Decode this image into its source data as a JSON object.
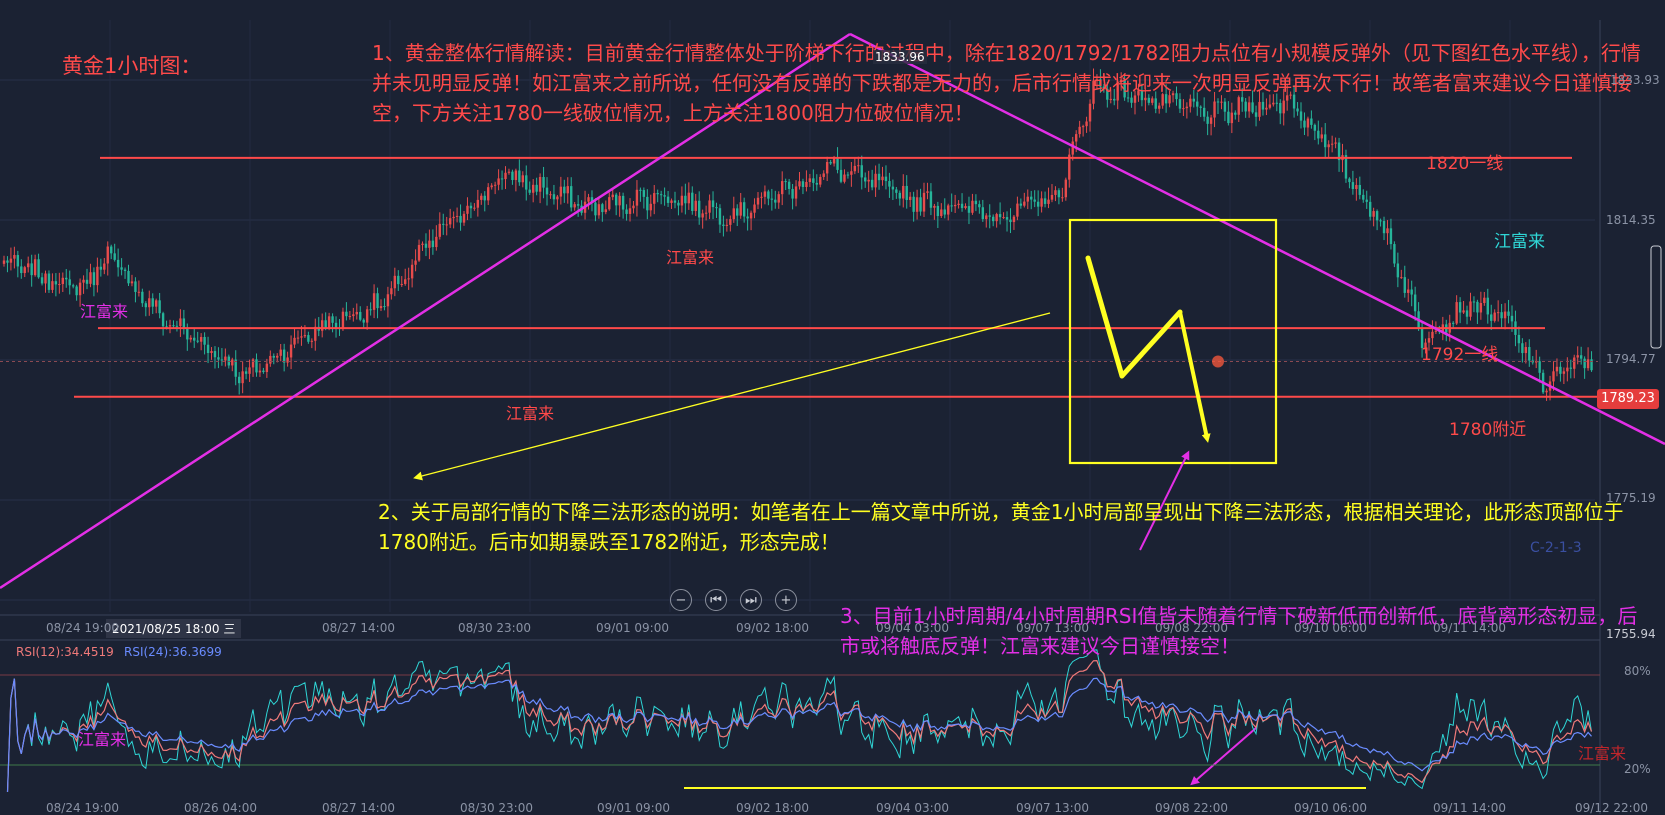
{
  "colors": {
    "background": "#1b2233",
    "candle_up": "#e74c4c",
    "candle_down": "#26b59a",
    "level_line": "#ff4a4a",
    "trend_line": "#e32fe6",
    "annotation_yellow": "#ffff22",
    "rsi12": "#f07a7a",
    "rsi24": "#6a8cff",
    "rsi6": "#2fd6d6",
    "price_tag_bg": "#e53d3d"
  },
  "chart_data": [
    {
      "type": "candlestick",
      "title": "黄金1小时图：",
      "ylim": [
        1752,
        1840
      ],
      "price_axis_labels": [
        "1833.93",
        "1814.35",
        "1794.77",
        "1775.19",
        "1755.94"
      ],
      "last_price": "1789.23",
      "high_label": "1833.96",
      "hover_time": "2021/08/25 18:00 三",
      "time_labels": [
        "08/24 19:00",
        "08/27 14:00",
        "08/30 23:00",
        "09/01 09:00",
        "09/02 18:00",
        "09/04 03:00",
        "09/07 13:00",
        "09/08 22:00",
        "09/10 06:00",
        "09/11 14:00"
      ],
      "keypoints": [
        {
          "i": 0,
          "p": 1804
        },
        {
          "i": 22,
          "p": 1800
        },
        {
          "i": 30,
          "p": 1805
        },
        {
          "i": 45,
          "p": 1796
        },
        {
          "i": 60,
          "p": 1791
        },
        {
          "i": 70,
          "p": 1787
        },
        {
          "i": 90,
          "p": 1794
        },
        {
          "i": 110,
          "p": 1798
        },
        {
          "i": 125,
          "p": 1808
        },
        {
          "i": 145,
          "p": 1817
        },
        {
          "i": 170,
          "p": 1812
        },
        {
          "i": 190,
          "p": 1814
        },
        {
          "i": 210,
          "p": 1811
        },
        {
          "i": 240,
          "p": 1818
        },
        {
          "i": 265,
          "p": 1813
        },
        {
          "i": 290,
          "p": 1811
        },
        {
          "i": 305,
          "p": 1814
        },
        {
          "i": 315,
          "p": 1830
        },
        {
          "i": 325,
          "p": 1829
        },
        {
          "i": 350,
          "p": 1826
        },
        {
          "i": 372,
          "p": 1828
        },
        {
          "i": 385,
          "p": 1820
        },
        {
          "i": 400,
          "p": 1808
        },
        {
          "i": 410,
          "p": 1793
        },
        {
          "i": 425,
          "p": 1798
        },
        {
          "i": 435,
          "p": 1795
        },
        {
          "i": 445,
          "p": 1786
        },
        {
          "i": 455,
          "p": 1789
        }
      ],
      "levels": [
        {
          "label": "1820一线",
          "value": 1819.5
        },
        {
          "label": "1792一线",
          "value": 1794.2
        },
        {
          "label": "1780附近",
          "value": 1784.0
        }
      ]
    },
    {
      "type": "line",
      "title": "RSI",
      "series": [
        {
          "name": "RSI(12):34.4519"
        },
        {
          "name": "RSI(24):36.3699"
        }
      ],
      "ylim": [
        0,
        100
      ],
      "levels": [
        80,
        20
      ],
      "y_tick_labels": [
        "80%",
        "20%"
      ],
      "time_labels": [
        "08/24 19:00",
        "08/26 04:00",
        "08/27 14:00",
        "08/30 23:00",
        "09/01 09:00",
        "09/02 18:00",
        "09/04 03:00",
        "09/07 13:00",
        "09/08 22:00",
        "09/10 06:00",
        "09/11 14:00",
        "09/12 22:00"
      ]
    }
  ],
  "annotations": {
    "text1": "1、黄金整体行情解读：目前黄金行情整体处于阶梯下行的过程中，除在1820/1792/1782阻力点位有小规模反弹外（见下图红色水平线），行情并未见明显反弹！如江富来之前所说，任何没有反弹的下跌都是无力的，后市行情或将迎来一次明显反弹再次下行！故笔者富来建议今日谨慎接空，下方关注1780一线破位情况，上方关注1800阻力位破位情况！",
    "text2": "2、关于局部行情的下降三法形态的说明：如笔者在上一篇文章中所说，黄金1小时局部呈现出下降三法形态，根据相关理论，此形态顶部位于1780附近。后市如期暴跌至1782附近，形态完成！",
    "text3": "3、目前1小时周期/4小时周期RSI值皆未随着行情下破新低而创新低，底背离形态初显，后市或将触底反弹！江富来建议今日谨慎接空！",
    "watermark": "江富来",
    "indicator_code": "C-2-1-3"
  },
  "controls": {
    "zoom_out": "−",
    "prev": "⏮",
    "next": "⏭",
    "zoom_in": "+"
  }
}
